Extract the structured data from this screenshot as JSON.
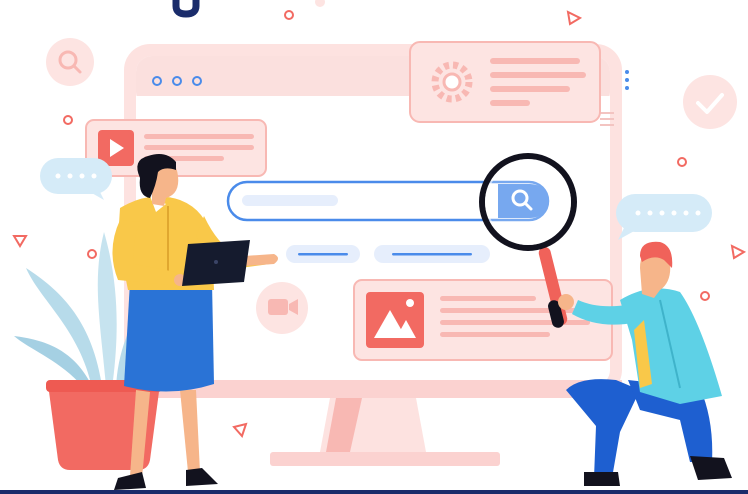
{
  "illustration": {
    "subject": "search",
    "colors": {
      "monitor_frame": "#fbd2d0",
      "monitor_screen": "#ffffff",
      "accent_red": "#f26a62",
      "light_pink": "#fde4e2",
      "search_blue": "#4a8bea",
      "search_bar_fill": "#e6eefc",
      "magnifier_handle": "#f0625a",
      "magnifier_ring": "#12121e",
      "woman_top": "#f9c849",
      "woman_skirt": "#2a73d6",
      "woman_skin": "#f6b58a",
      "man_jacket": "#5ed1e6",
      "man_pants": "#1e5fd0",
      "man_hair": "#f0625a",
      "plant_leaves": "#b7dbea",
      "pot": "#f26a62",
      "laptop": "#151b2e",
      "bubble": "#d5ebf8",
      "logo_navy": "#1a2c6b"
    },
    "icons": [
      "search-icon",
      "gear-icon",
      "play-icon",
      "image-icon",
      "video-camera-icon",
      "check-icon",
      "magnifying-glass-icon",
      "menu-dots-icon",
      "chat-bubble-icon"
    ]
  }
}
